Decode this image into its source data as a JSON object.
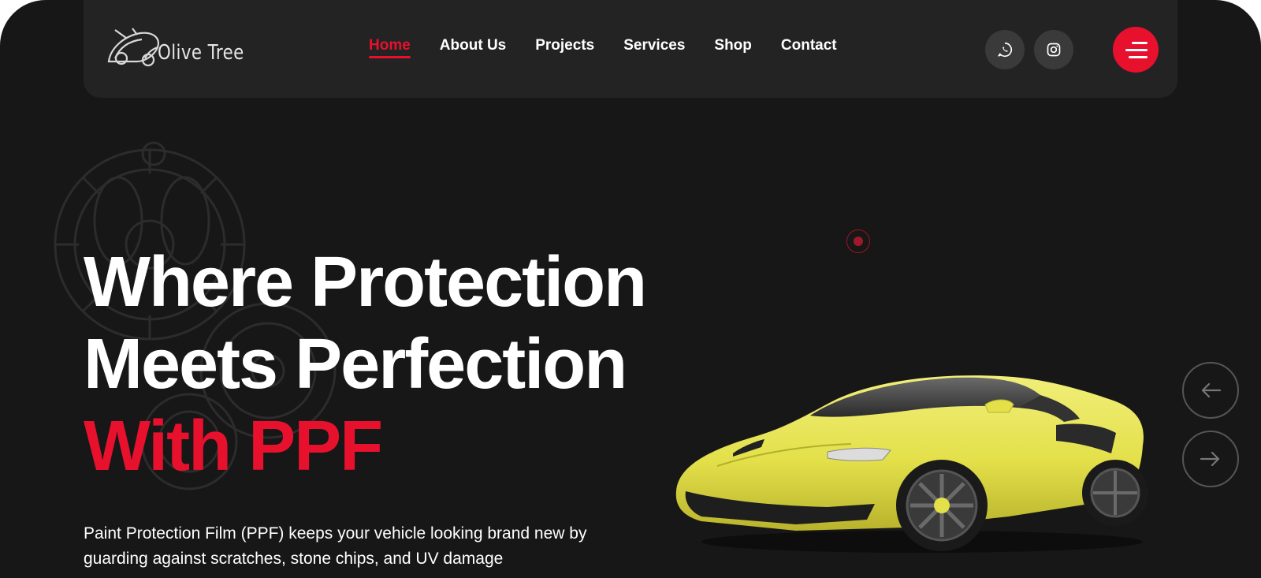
{
  "brand": {
    "name": "Olive Tree"
  },
  "nav": {
    "items": [
      {
        "label": "Home",
        "active": true
      },
      {
        "label": "About Us",
        "active": false
      },
      {
        "label": "Projects",
        "active": false
      },
      {
        "label": "Services",
        "active": false
      },
      {
        "label": "Shop",
        "active": false
      },
      {
        "label": "Contact",
        "active": false
      }
    ]
  },
  "social": {
    "icons": [
      "whatsapp-icon",
      "instagram-icon"
    ]
  },
  "menu": {
    "icon": "hamburger-menu-icon"
  },
  "hero": {
    "line1": "Where Protection",
    "line2": "Meets Perfection",
    "line3": "With PPF",
    "description": "Paint Protection Film (PPF) keeps your vehicle looking brand new by guarding against scratches, stone chips, and UV damage"
  },
  "slider": {
    "prev_icon": "arrow-left-icon",
    "next_icon": "arrow-right-icon"
  },
  "colors": {
    "accent": "#e8112d",
    "background": "#171717",
    "header": "#232323",
    "car": "#e3e04a"
  }
}
